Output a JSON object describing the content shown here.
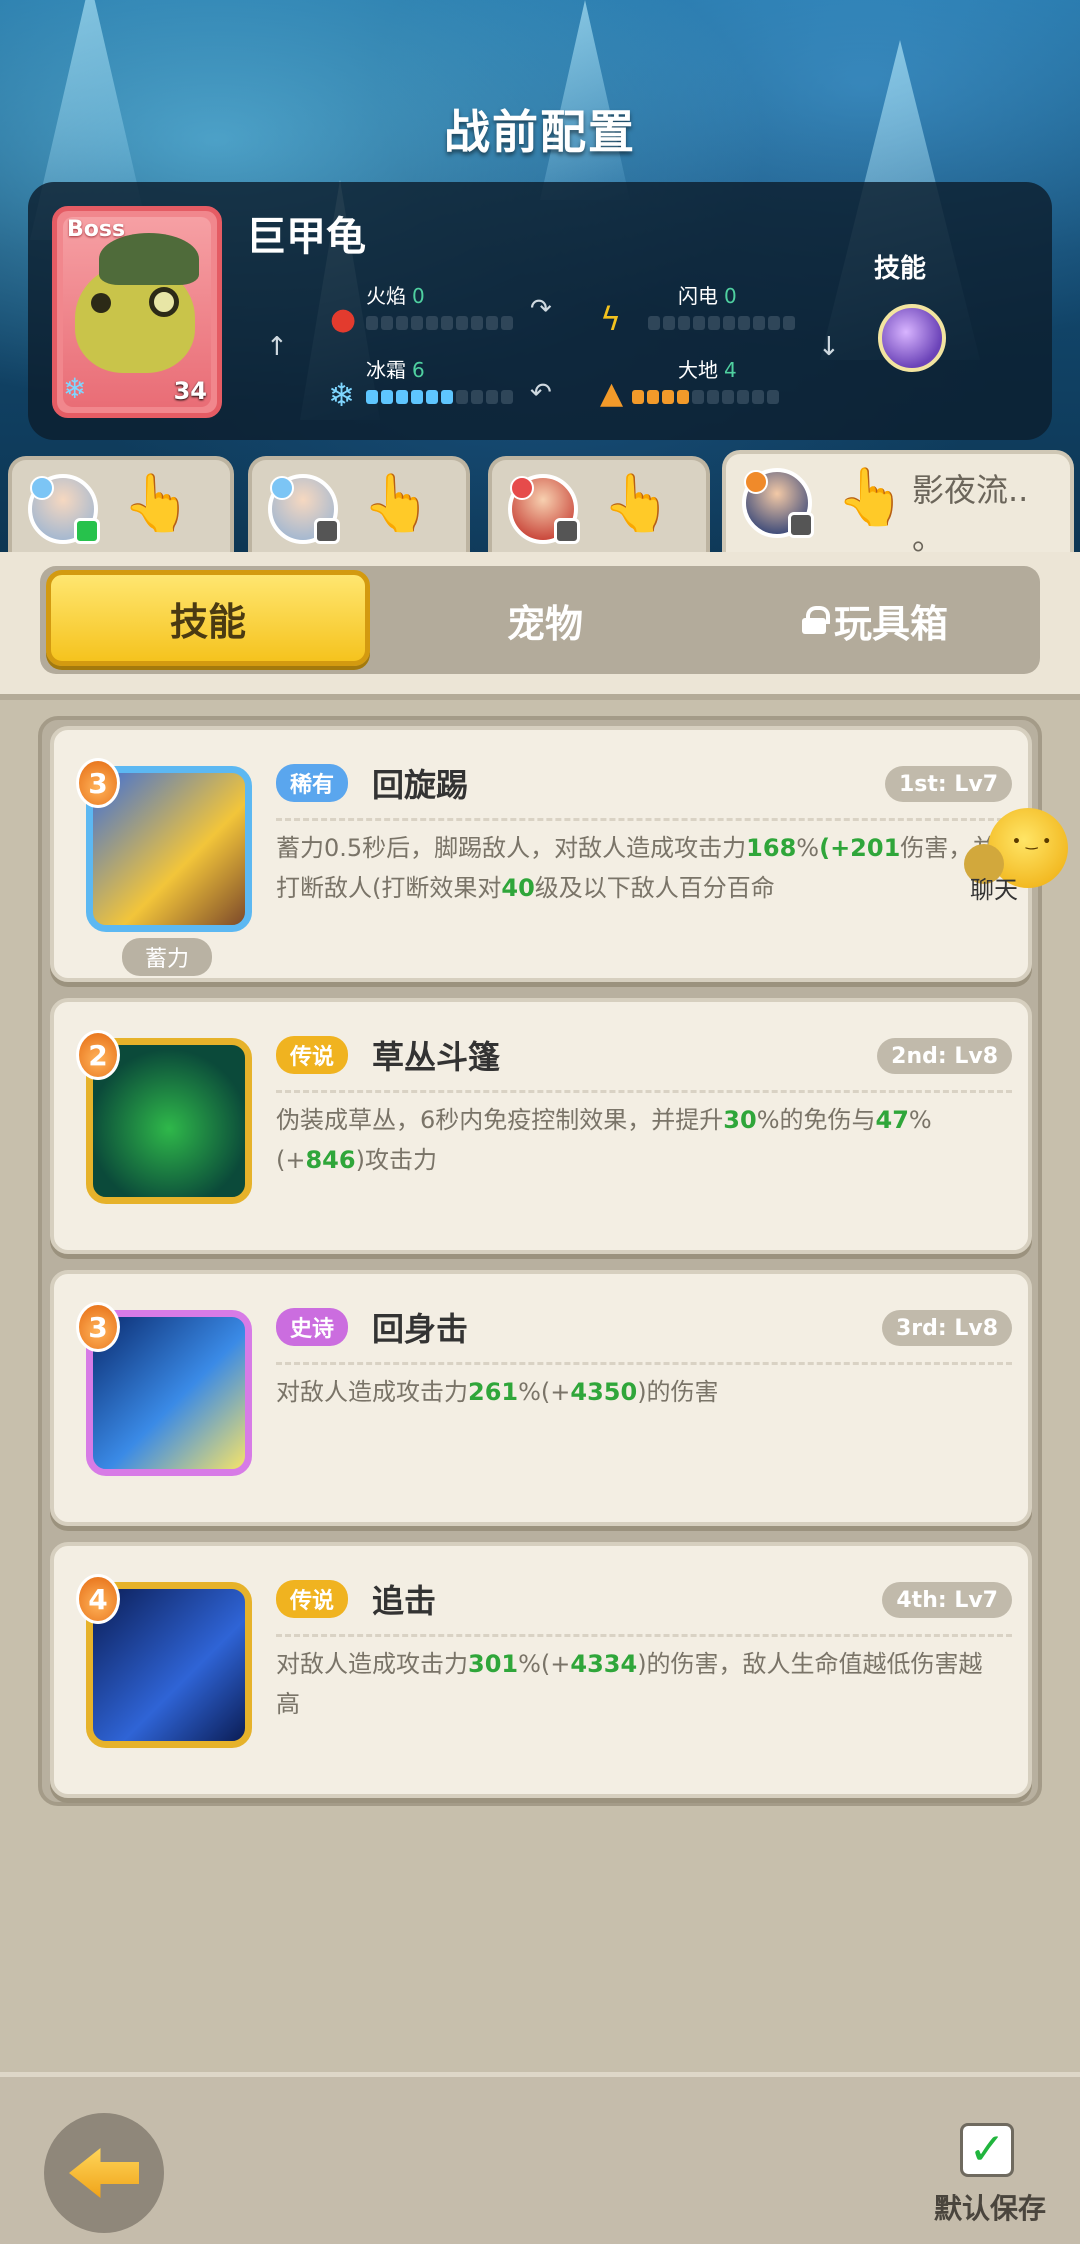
{
  "header": {
    "title": "战前配置"
  },
  "boss": {
    "tag": "Boss",
    "name": "巨甲龟",
    "level": "34",
    "skill_label": "技能",
    "stats": [
      {
        "label": "火焰",
        "value": "0",
        "filled": 0,
        "color": "#e33b2e"
      },
      {
        "label": "闪电",
        "value": "0",
        "filled": 0,
        "color": "#f2c21e"
      },
      {
        "label": "冰霜",
        "value": "6",
        "filled": 6,
        "color": "#5ec6ff"
      },
      {
        "label": "大地",
        "value": "4",
        "filled": 4,
        "color": "#f29a2a"
      }
    ]
  },
  "heroes": [
    {
      "name": "",
      "active": false
    },
    {
      "name": "",
      "active": false
    },
    {
      "name": "",
      "active": false
    },
    {
      "name": "影夜流..",
      "name_line2": "。",
      "active": true
    }
  ],
  "tabs": [
    {
      "label": "技能",
      "active": true
    },
    {
      "label": "宠物",
      "active": false
    },
    {
      "label": "玩具箱",
      "active": false,
      "locked": true
    }
  ],
  "skills": [
    {
      "order": "3",
      "rarity": "稀有",
      "rarity_type": "rare",
      "name": "回旋踢",
      "level": "1st: Lv7",
      "badge": "蓄力",
      "desc_parts": [
        {
          "t": "蓄力0.5秒后，脚踢敌人，对敌人造成攻击力"
        },
        {
          "t": "168",
          "g": true
        },
        {
          "t": "%"
        },
        {
          "t": "(+201",
          "g": true
        },
        {
          "t": "伤害，并打断敌人(打断效果对"
        },
        {
          "t": "40",
          "g": true
        },
        {
          "t": "级及以下敌人百分百命"
        }
      ]
    },
    {
      "order": "2",
      "rarity": "传说",
      "rarity_type": "legend",
      "name": "草丛斗篷",
      "level": "2nd: Lv8",
      "desc_parts": [
        {
          "t": "伪装成草丛，6秒内免疫控制效果，并提升"
        },
        {
          "t": "30",
          "g": true
        },
        {
          "t": "%的免伤与"
        },
        {
          "t": "47",
          "g": true
        },
        {
          "t": "%(+"
        },
        {
          "t": "846",
          "g": true
        },
        {
          "t": ")攻击力"
        }
      ]
    },
    {
      "order": "3",
      "rarity": "史诗",
      "rarity_type": "epic",
      "name": "回身击",
      "level": "3rd: Lv8",
      "desc_parts": [
        {
          "t": "对敌人造成攻击力"
        },
        {
          "t": "261",
          "g": true
        },
        {
          "t": "%(+"
        },
        {
          "t": "4350",
          "g": true
        },
        {
          "t": ")的伤害"
        }
      ]
    },
    {
      "order": "4",
      "rarity": "传说",
      "rarity_type": "legend",
      "name": "追击",
      "level": "4th: Lv7",
      "desc_parts": [
        {
          "t": "对敌人造成攻击力"
        },
        {
          "t": "301",
          "g": true
        },
        {
          "t": "%(+"
        },
        {
          "t": "4334",
          "g": true
        },
        {
          "t": ")的伤害，敌人生命值越低伤害越高"
        }
      ]
    }
  ],
  "chat": {
    "label": "聊天"
  },
  "footer": {
    "save_label": "默认保存"
  }
}
